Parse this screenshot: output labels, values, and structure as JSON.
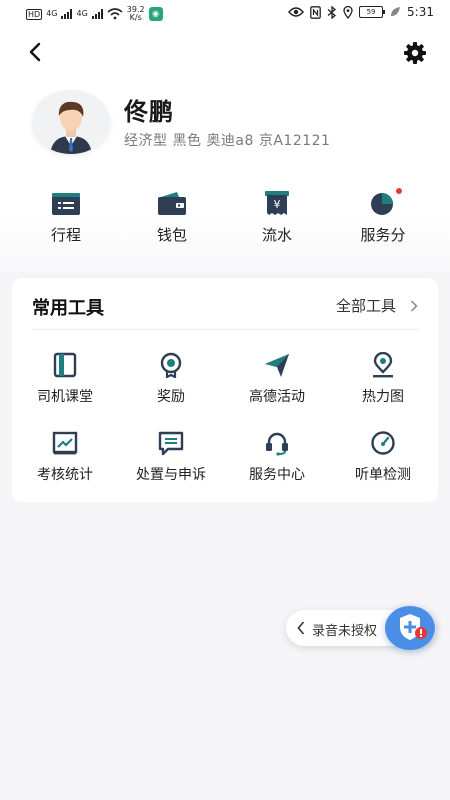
{
  "status_bar": {
    "carrier_left": "HD",
    "net1": "4G",
    "net2": "4G",
    "speed_value": "39.2",
    "speed_unit": "K/s",
    "battery": "59",
    "time": "5:31"
  },
  "profile": {
    "name": "佟鹏",
    "car_info": "经济型 黑色 奥迪a8   京A12121"
  },
  "quick_actions": [
    {
      "label": "行程",
      "icon": "trip-icon"
    },
    {
      "label": "钱包",
      "icon": "wallet-icon"
    },
    {
      "label": "流水",
      "icon": "bill-icon"
    },
    {
      "label": "服务分",
      "icon": "pie-chart-icon",
      "has_badge": true
    }
  ],
  "tools": {
    "title": "常用工具",
    "all_label": "全部工具",
    "items": [
      {
        "label": "司机课堂",
        "icon": "book-icon"
      },
      {
        "label": "奖励",
        "icon": "award-icon"
      },
      {
        "label": "高德活动",
        "icon": "paper-plane-icon"
      },
      {
        "label": "热力图",
        "icon": "location-pin-icon"
      },
      {
        "label": "考核统计",
        "icon": "trend-chart-icon"
      },
      {
        "label": "处置与申诉",
        "icon": "message-icon"
      },
      {
        "label": "服务中心",
        "icon": "headset-icon"
      },
      {
        "label": "听单检测",
        "icon": "gauge-icon"
      }
    ]
  },
  "recorder": {
    "label": "录音未授权"
  },
  "colors": {
    "accent_teal": "#1f7f7f",
    "icon_dark": "#2e3e54",
    "fab_blue": "#4a8ee8",
    "alert_red": "#e53935"
  }
}
